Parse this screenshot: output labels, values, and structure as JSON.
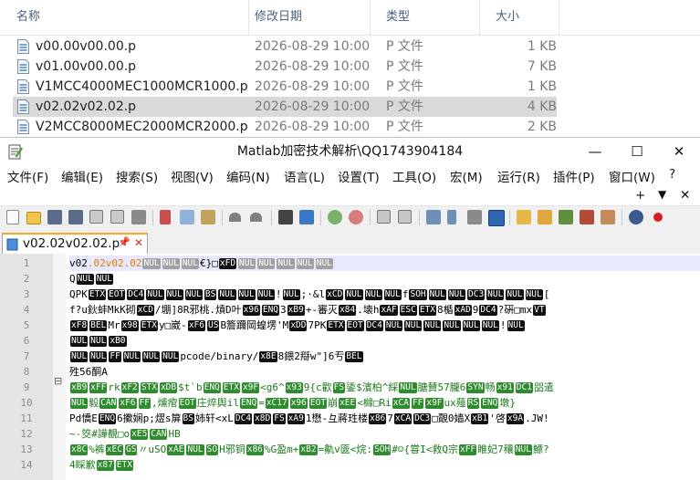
{
  "explorer": {
    "columns": {
      "name": "名称",
      "date": "修改日期",
      "type": "类型",
      "size": "大小"
    },
    "files": [
      {
        "name": "v00.00v00.00.p",
        "date": "2026-08-29 10:00",
        "type": "P 文件",
        "size": "1 KB",
        "selected": false
      },
      {
        "name": "v01.00v00.00.p",
        "date": "2026-08-29 10:00",
        "type": "P 文件",
        "size": "7 KB",
        "selected": false
      },
      {
        "name": "V1MCC4000MEC1000MCR1000.p",
        "date": "2026-08-29 10:00",
        "type": "P 文件",
        "size": "1 KB",
        "selected": false
      },
      {
        "name": "v02.02v02.02.p",
        "date": "2026-08-29 10:00",
        "type": "P 文件",
        "size": "4 KB",
        "selected": true
      },
      {
        "name": "V2MCC8000MEC2000MCR2000.p",
        "date": "2026-08-29 10:00",
        "type": "P 文件",
        "size": "2 KB",
        "selected": false
      }
    ]
  },
  "window": {
    "title": "Matlab加密技术解析\\QQ1743904184",
    "minimize": "—",
    "maximize": "☐",
    "close": "✕"
  },
  "menu": {
    "file": "文件(F)",
    "edit": "编辑(E)",
    "search": "搜索(S)",
    "view": "视图(V)",
    "encoding": "编码(N)",
    "language": "语言(L)",
    "settings": "设置(T)",
    "tools": "工具(O)",
    "macro": "宏(M)",
    "run": "运行(R)",
    "plugins": "插件(P)",
    "window": "窗口(W)",
    "help": "?",
    "plus": "+",
    "dropdown": "▼",
    "close_doc": "✕"
  },
  "tab": {
    "name": "v02.02v02.02.p",
    "pin": "📌",
    "close": "✕"
  },
  "editor": {
    "line_numbers": [
      "1",
      "2",
      "3",
      "4",
      "5",
      "6",
      "7",
      "8",
      "9",
      "10",
      "11",
      "12",
      "13",
      "14"
    ],
    "fold_marker": "⊟",
    "lines": [
      "v02.02v02.02 NUL NUL NUL €}□ xFD NUL NUL NUL NUL NUL",
      "Q NUL NUL",
      "QPK ETX EOT DC4 NUL NUL NUL BS NUL NUL NUL ! NUL ;·&l xCD NUL NUL NUL f SOH NUL NUL DC3 NUL NUL NUL [",
      "f?u鈥蚌MkK砌 xCD /堋]8R邪桃.熕D叶 x96 ENQ 3 xB9 +-審灭 x84 .壊h xAF ESC ETX 8楯 xAD 9 DC4 ?硏□mx VT",
      "xF8 BEL Mr x98 ETX y□崴- xF6 US B簷躎岡蝗塄'M xDD 7PK ETX EOT DC4 NUL NUL NUL NUL NUL NUL ! NUL",
      "NUL NUL xB0",
      "NUL NUL FF NUL NUL NUL pcode/binary/ x8E 8鍡2搿w\"]6亐 BEL",
      "殅56酮A",
      "xB9 xFF rk xF2 STX xDB $t`b ENQ ETX x9F <g6^ x93 9{c歡 FS 鋈$濱柏^綵 NUL 膅賛57朧6 SYN 畅 x91 DC1 㗊遣",
      "NUL 毅 CAN xF6 FF ,燻痯 EOT 庄焠舆il ENQ = xC17 x96 EOT 崩 xEE <櫞□Ri xCA FF x9F ux薤 RS ENQ 墩}",
      "Pd憍E ENQ 6擹娴p;熤s箳 BS 姉轩<xL DC4 x8D FS xA9 1懋-彑蔣珄楼 x86 7 xCA DC3 □覿0嫱X xB1 '啓 x9A .JW!",
      "~-筊#譁覩□o xE5 CAN HB",
      "x8C %裤 xEC GS 〃uSO xAE NUL SO H邪铜 x86 %G盈m+ xB2 =鼽v匳<烷: SOH #☺{甞I<救Q宗 xFF 睢妃7穰 NUL 鰾?",
      "4睬歉 x87 ETX"
    ]
  }
}
